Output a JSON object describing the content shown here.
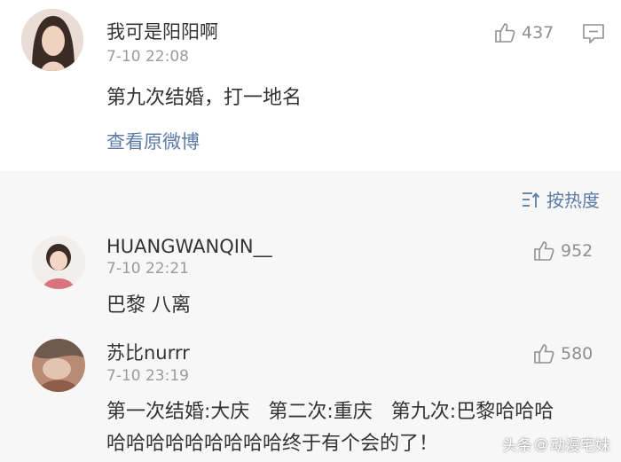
{
  "post": {
    "author": "我可是阳阳啊",
    "time": "7-10 22:08",
    "likes": "437",
    "text": "第九次结婚，打一地名",
    "view_original": "查看原微博",
    "icons": {
      "like": "thumbs-up-icon",
      "comment": "comment-icon"
    }
  },
  "sort": {
    "label": "按热度",
    "icon": "sort-icon"
  },
  "replies": [
    {
      "author": "HUANGWANQIN__",
      "time": "7-10 22:21",
      "likes": "952",
      "text_lines": [
        "巴黎 八离"
      ]
    },
    {
      "author": "苏比nurrr",
      "time": "7-10 23:19",
      "likes": "580",
      "text_lines": [
        "第一次结婚:大庆   第二次:重庆   第九次:巴黎哈哈哈",
        "哈哈哈哈哈哈哈哈哈终于有个会的了！"
      ]
    }
  ],
  "watermark": {
    "prefix": "头条",
    "at": "@",
    "account": "动漫宅妹"
  },
  "colors": {
    "background": "#f7f7f7",
    "card": "#ffffff",
    "link": "#5b7ba6",
    "muted": "#9b9b9b",
    "text": "#333333"
  }
}
